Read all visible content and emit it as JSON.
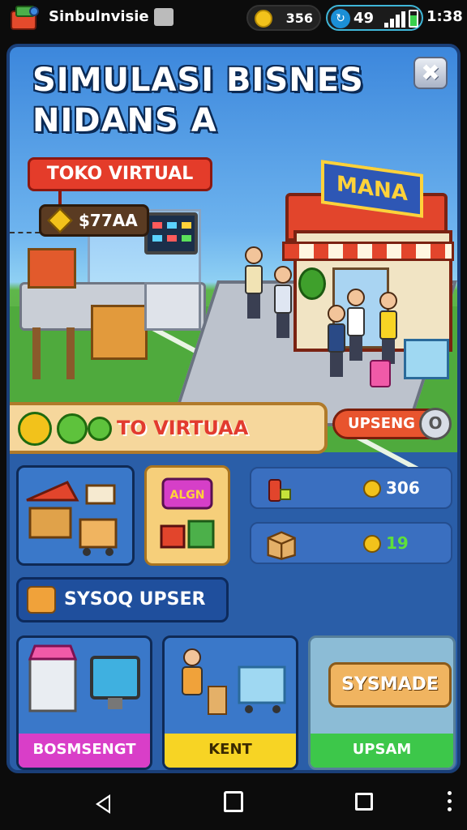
{
  "status_bar": {
    "app_name": "Sinbulnvisie",
    "coins": "356",
    "signal": "49",
    "time": "1:38"
  },
  "game": {
    "title_line1": "SIMULASI BISNES",
    "title_line2": "NIDANS A",
    "close_symbol": "✖",
    "store_label": "TOKO VIRTUAL",
    "store_value": "$77AA",
    "shop_sign": "MANA",
    "banner_label": "TO VIRTUAA",
    "upgrade_label": "UPSENG",
    "upgrade_knob": "O",
    "stats": [
      {
        "icon": "fire-extinguisher-icon",
        "value": "306"
      },
      {
        "icon": "box-icon",
        "value": "19"
      }
    ],
    "tile_sale_text": "ALGN",
    "wide_button_label": "SYSOQ UPSER",
    "cards": [
      {
        "label": "BOSMSENGT"
      },
      {
        "label": "KENT"
      },
      {
        "label": "UPSAM",
        "button": "SYSMADE"
      }
    ]
  },
  "colors": {
    "panel": "#2a5ea8",
    "accent_red": "#e43c2a",
    "banner": "#f6d79c",
    "magenta": "#d93ec8",
    "yellow": "#f7d424",
    "green": "#3dc74a"
  }
}
